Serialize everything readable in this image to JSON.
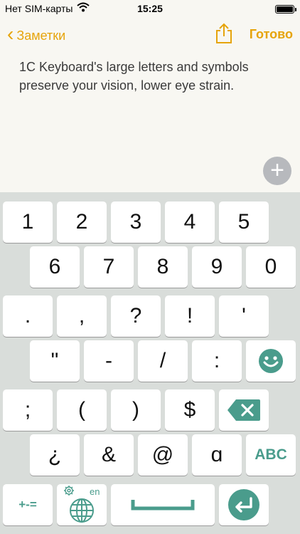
{
  "status_bar": {
    "carrier": "Нет SIM-карты",
    "time": "15:25"
  },
  "nav": {
    "back_label": "Заметки",
    "done_label": "Готово"
  },
  "note": {
    "text": "1C Keyboard's large letters and symbols preserve your vision, lower eye strain."
  },
  "keyboard": {
    "row1": [
      "1",
      "2",
      "3",
      "4",
      "5"
    ],
    "row2": [
      "6",
      "7",
      "8",
      "9",
      "0"
    ],
    "row3": [
      ".",
      ",",
      "?",
      "!",
      "'"
    ],
    "row4": [
      "\"",
      "-",
      "/",
      ":"
    ],
    "row5": [
      ";",
      "(",
      ")",
      "$"
    ],
    "row6": [
      "¿",
      "&",
      "@",
      "ɑ"
    ],
    "abc_label": "ABC",
    "symbols_label": "+-=",
    "language_badge": "en"
  },
  "colors": {
    "accent": "#e6a40b",
    "key_accent": "#4a9c8c",
    "keyboard_bg": "#d9ddda"
  }
}
